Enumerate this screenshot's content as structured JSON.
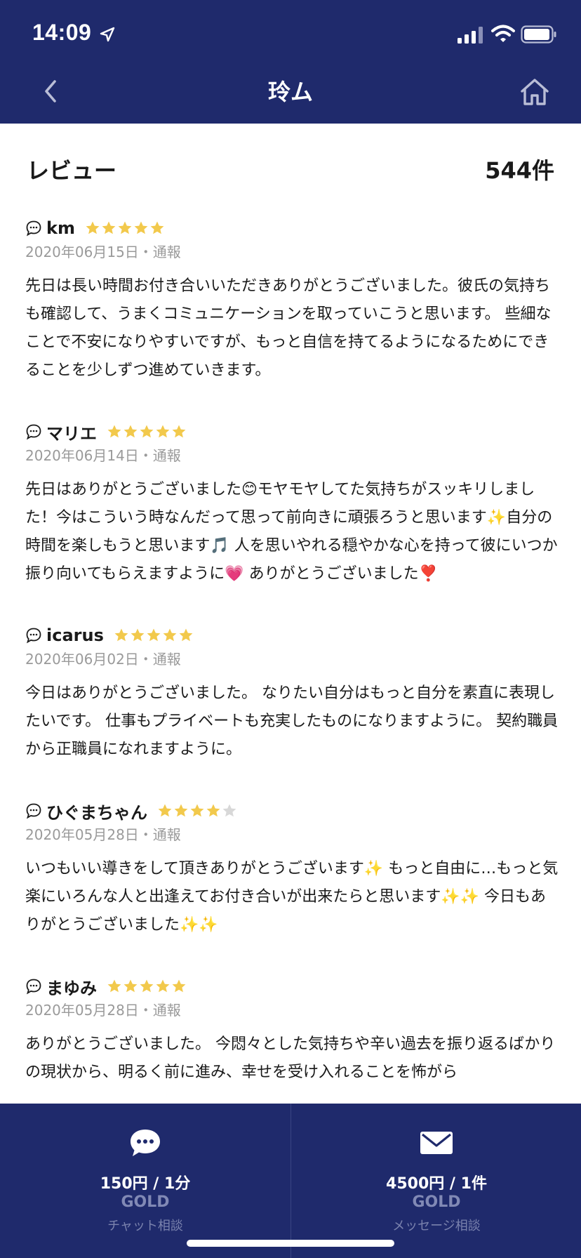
{
  "status": {
    "time": "14:09"
  },
  "nav": {
    "title": "玲ム"
  },
  "section": {
    "title": "レビュー",
    "count": "544件"
  },
  "colors": {
    "header": "#1f2a6c",
    "star": "#f2c94c",
    "star_empty": "#d8d8d8"
  },
  "reviews": [
    {
      "name": "km",
      "rating": 5,
      "date": "2020年06月15日",
      "sep": "・",
      "report": "通報",
      "text": "先日は長い時間お付き合いいただきありがとうございました。彼氏の気持ちも確認して、うまくコミュニケーションを取っていこうと思います。 些細なことで不安になりやすいですが、もっと自信を持てるようになるためにできることを少しずつ進めていきます。"
    },
    {
      "name": "マリエ",
      "rating": 5,
      "date": "2020年06月14日",
      "sep": "・",
      "report": "通報",
      "text": "先日はありがとうございました😊モヤモヤしてた気持ちがスッキリしました！今はこういう時なんだって思って前向きに頑張ろうと思います✨自分の時間を楽しもうと思います🎵 人を思いやれる穏やかな心を持って彼にいつか振り向いてもらえますように💗 ありがとうございました❣️"
    },
    {
      "name": "icarus",
      "rating": 5,
      "date": "2020年06月02日",
      "sep": "・",
      "report": "通報",
      "text": "今日はありがとうございました。 なりたい自分はもっと自分を素直に表現したいです。 仕事もプライベートも充実したものになりますように。 契約職員から正職員になれますように。"
    },
    {
      "name": "ひぐまちゃん",
      "rating": 4,
      "date": "2020年05月28日",
      "sep": "・",
      "report": "通報",
      "text": "いつもいい導きをして頂きありがとうございます✨ もっと自由に…もっと気楽にいろんな人と出逢えてお付き合いが出来たらと思います✨✨ 今日もありがとうございました✨✨"
    },
    {
      "name": "まゆみ",
      "rating": 5,
      "date": "2020年05月28日",
      "sep": "・",
      "report": "通報",
      "text": "ありがとうございました。 今悶々とした気持ちや辛い過去を振り返るばかりの現状から、明るく前に進み、幸せを受け入れることを怖がら"
    }
  ],
  "bottom": {
    "chat": {
      "price": "150円 / 1分",
      "tier": "GOLD",
      "label": "チャット相談",
      "icon": "chat-bubble-icon"
    },
    "message": {
      "price": "4500円 / 1件",
      "tier": "GOLD",
      "label": "メッセージ相談",
      "icon": "envelope-icon"
    }
  }
}
